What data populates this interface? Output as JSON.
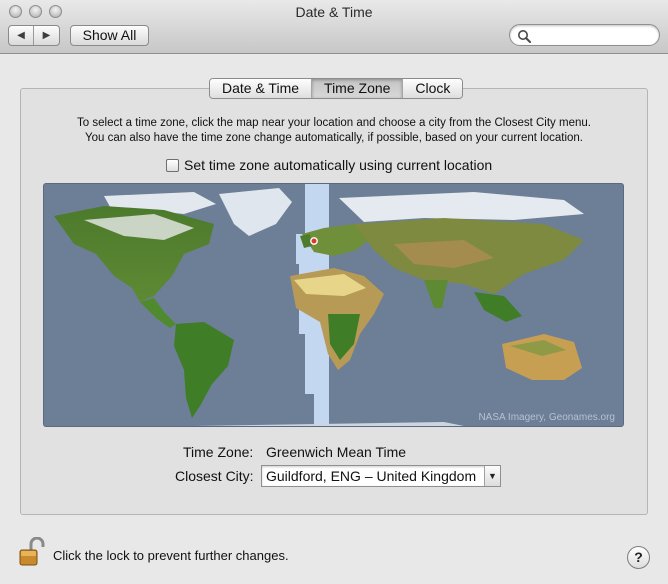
{
  "window": {
    "title": "Date & Time"
  },
  "toolbar": {
    "back_icon": "left-arrow-icon",
    "forward_icon": "right-arrow-icon",
    "show_all_label": "Show All",
    "search_value": "",
    "search_icon": "magnifier-icon"
  },
  "tabs": [
    {
      "label": "Date & Time",
      "active": false
    },
    {
      "label": "Time Zone",
      "active": true
    },
    {
      "label": "Clock",
      "active": false
    }
  ],
  "time_zone_panel": {
    "instructions_line1": "To select a time zone, click the map near your location and choose a city from the Closest City menu.",
    "instructions_line2": "You can also have the time zone change automatically, if possible, based on your current location.",
    "auto_checkbox_label": "Set time zone automatically using current location",
    "auto_checked": false,
    "map_credit": "NASA Imagery, Geonames.org",
    "time_zone_label": "Time Zone:",
    "time_zone_value": "Greenwich Mean Time",
    "closest_city_label": "Closest City:",
    "closest_city_value": "Guildford, ENG – United Kingdom"
  },
  "footer": {
    "lock_text": "Click the lock to prevent further changes.",
    "lock_icon": "unlocked-padlock-icon",
    "help_label": "?"
  },
  "colors": {
    "ocean": "#6d7e97",
    "timezone_band": "#c9dcf5",
    "location_marker": "#e0392a"
  }
}
